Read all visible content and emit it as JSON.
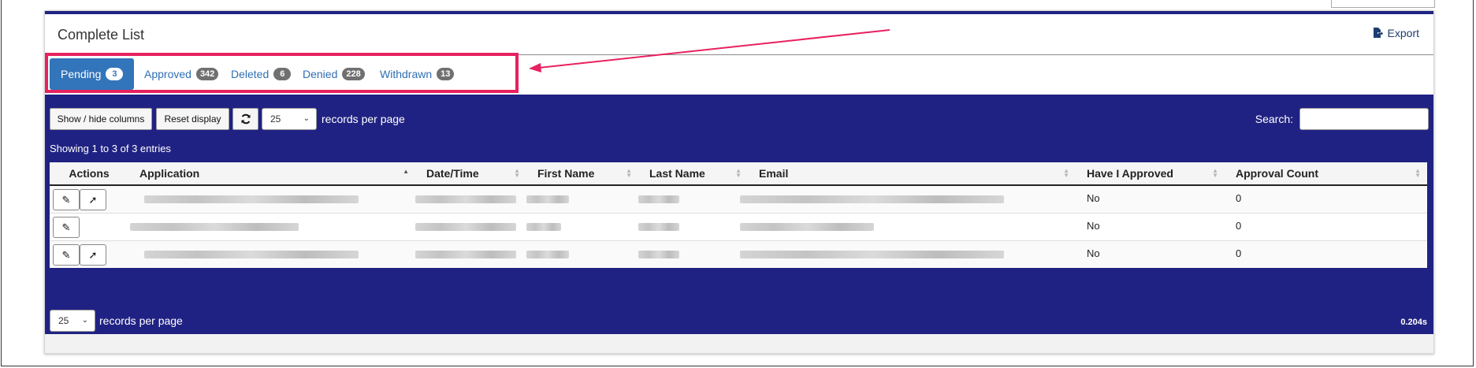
{
  "panel": {
    "title": "Complete List",
    "export_label": "Export"
  },
  "tabs": [
    {
      "label": "Pending",
      "count": "3",
      "active": true
    },
    {
      "label": "Approved",
      "count": "342",
      "active": false
    },
    {
      "label": "Deleted",
      "count": "6",
      "active": false
    },
    {
      "label": "Denied",
      "count": "228",
      "active": false
    },
    {
      "label": "Withdrawn",
      "count": "13",
      "active": false
    }
  ],
  "toolbar": {
    "show_hide_label": "Show / hide columns",
    "reset_label": "Reset display",
    "refresh_icon": "refresh-icon",
    "page_size": "25",
    "records_per_page": "records per page",
    "search_label": "Search:",
    "search_value": ""
  },
  "info": "Showing 1 to 3 of 3 entries",
  "table": {
    "columns": [
      "Actions",
      "Application",
      "Date/Time",
      "First Name",
      "Last Name",
      "Email",
      "Have I Approved",
      "Approval Count"
    ],
    "rows": [
      {
        "approved": "No",
        "count": "0"
      },
      {
        "approved": "No",
        "count": "0"
      },
      {
        "approved": "No",
        "count": "0"
      }
    ]
  },
  "footer": {
    "page_size": "25",
    "records_per_page": "records per page",
    "timing": "0.204s"
  },
  "colors": {
    "brand_navy": "#202283",
    "tab_active": "#3375bb",
    "highlight": "#e8215f"
  }
}
